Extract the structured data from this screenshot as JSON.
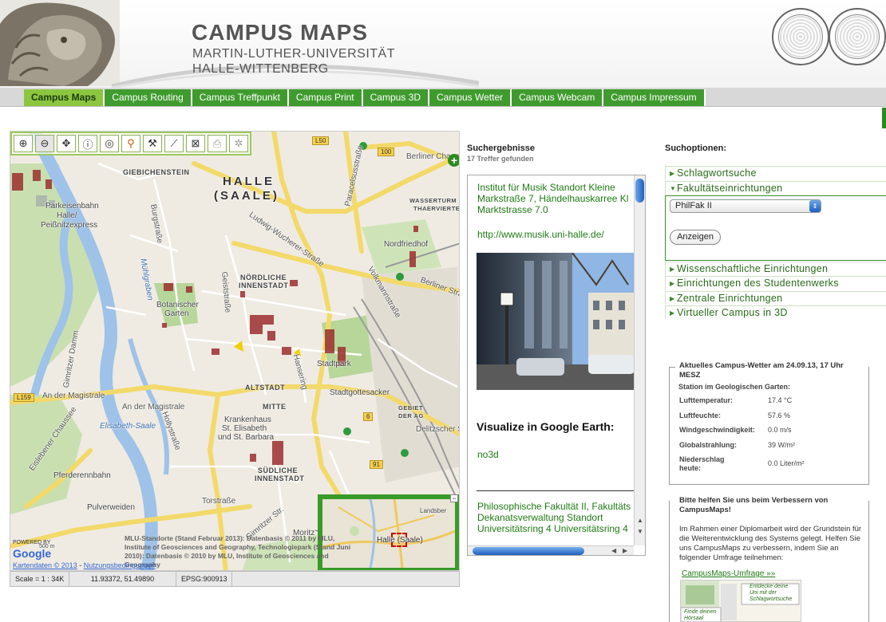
{
  "header": {
    "title": "CAMPUS MAPS",
    "subtitle_line1": "MARTIN-LUTHER-UNIVERSITÄT",
    "subtitle_line2": "HALLE-WITTENBERG"
  },
  "nav": {
    "tabs": [
      {
        "label": "Campus Maps",
        "active": true
      },
      {
        "label": "Campus Routing",
        "active": false
      },
      {
        "label": "Campus Treffpunkt",
        "active": false
      },
      {
        "label": "Campus Print",
        "active": false
      },
      {
        "label": "Campus 3D",
        "active": false
      },
      {
        "label": "Campus Wetter",
        "active": false
      },
      {
        "label": "Campus Webcam",
        "active": false
      },
      {
        "label": "Campus Impressum",
        "active": false
      }
    ]
  },
  "map": {
    "tools": [
      "zoom-in-icon",
      "zoom-out-icon",
      "pan-icon",
      "info-icon",
      "zoom-extent-icon",
      "search-icon",
      "measure-icon",
      "ruler-icon",
      "clear-icon",
      "print-icon",
      "settings-icon"
    ],
    "labels": {
      "city": "HALLE",
      "city2": "(SAALE)",
      "giebichenstein": "GIEBICHENSTEIN",
      "parkeisenbahn1": "Parkeisenbahn",
      "parkeisenbahn2": "Halle/",
      "parkeisenbahn3": "Peißnitzexpress",
      "burgstrasse": "Burgstraße",
      "paracelsus": "Paracelsusstraße",
      "berliner_chaussee": "Berliner Chaussee",
      "wasserturm1": "WASSERTURM -",
      "wasserturm2": "THAERVIERTEL",
      "nordfriedhof": "Nordfriedhof",
      "ludwig": "Ludwig-Wucherer-Straße",
      "berliner_strasse": "Berliner Straße",
      "volkmann": "Volkmannstraße",
      "noerdliche1": "NÖRDLICHE",
      "noerdliche2": "INNENSTADT",
      "botanischer1": "Botanischer",
      "botanischer2": "Garten",
      "geiststrasse": "Geiststraße",
      "muehlgraben": "Mühlgraben",
      "gimritzer_damm": "Gimritzer Damm",
      "altstadt": "ALTSTADT",
      "stadtpark": "Stadtpark",
      "hansering": "Hansering",
      "stadtgottesacker": "Stadtgottesacker",
      "l159": "L159",
      "magistrale1": "An der Magistrale",
      "magistrale2": "An der Magistrale",
      "mitte": "MITTE",
      "gebiet1": "GEBIET",
      "gebiet2": "DER AG",
      "krankenhaus1": "Krankenhaus",
      "krankenhaus2": "St. Elisabeth",
      "krankenhaus3": "und St. Barbara",
      "elisabeth_saale": "Elisabeth-Saale",
      "hollystrasse": "Hollystraße",
      "eislebener": "Eislebener Chaussee",
      "delitzscher": "Delitzscher S",
      "suedliche1": "SÜDLICHE",
      "suedliche2": "INNENSTADT",
      "pferderennbahn": "Pferderennbahn",
      "torstrasse": "Torstraße",
      "pulverweiden": "Pulverweiden",
      "gimritzer": "Gimritzer Str.",
      "leipziger": "Leipziger",
      "l50": "L50",
      "r100": "100",
      "r6": "6",
      "r91": "91",
      "moritz": "Moritz"
    },
    "overview": {
      "label": "Halle (Saale)",
      "landsberg": "Landsber"
    },
    "attribution": "MLU-Standorte (Stand Februar 2013): Datenbasis © 2011 by MLU, Institute of Geosciences and Geography, Technologiepark (Stand Juni 2010): Datenbasis © 2010 by MLU, Institute of Geosciences and Geography",
    "powered_by": "POWERED BY",
    "google": "Google",
    "scale_text": "500 m",
    "kartendaten": "Kartendaten © 2013",
    "nutzungs": "Nutzungsbedingungen",
    "status": {
      "scale": "Scale = 1 : 34K",
      "coords": "11.93372, 51.49890",
      "epsg": "EPSG:900913"
    }
  },
  "search_results": {
    "title": "Suchergebnisse",
    "count": "17 Treffer gefunden",
    "item1": [
      "Institut für Musik Standort Kleine",
      "Markstraße 7, Händelhauskarree Kl",
      "Marktstrasse 7.0"
    ],
    "item1_url": "http://www.musik.uni-halle.de/",
    "ge_title": "Visualize in Google Earth:",
    "ge_link": "no3d",
    "item2": [
      "Philosophische Fakultät II, Fakultäts",
      "Dekanatsverwaltung Standort",
      "Universitätsring 4 Universitätsring 4"
    ]
  },
  "search_options": {
    "title": "Suchoptionen:",
    "sections": [
      "Schlagwortsuche",
      "Fakultätseinrichtungen",
      "Wissenschaftliche Einrichtungen",
      "Einrichtungen des Studentenwerks",
      "Zentrale Einrichtungen",
      "Virtueller Campus in 3D"
    ],
    "selected_faculty": "PhilFak II",
    "show_button": "Anzeigen"
  },
  "weather": {
    "title": "Aktuelles Campus-Wetter am 24.09.13, 17 Uhr MESZ",
    "station": "Station im Geologischen Garten:",
    "rows": [
      {
        "label": "Lufttemperatur:",
        "value": "17.4 °C"
      },
      {
        "label": "Luftfeuchte:",
        "value": "57.6 %"
      },
      {
        "label": "Windgeschwindigkeit:",
        "value": "0.0 m/s"
      },
      {
        "label": "Globalstrahlung:",
        "value": "39 W/m²"
      },
      {
        "label": "Niederschlag heute:",
        "value": "0.0 Liter/m²"
      }
    ]
  },
  "feedback": {
    "title": "Bitte helfen Sie uns beim Verbessern von CampusMaps!",
    "text": "Im Rahmen einer Diplomarbeit wird der Grundstein für die Weiterentwicklung des Systems gelegt. Helfen Sie uns CampusMaps zu verbessern, indem Sie an folgender Umfrage teilnehmen:",
    "link": "CampusMaps-Umfrage  »»",
    "img_text1": "Entdecke deine",
    "img_text2": "Uni mit der",
    "img_text3": "Schlagwortsuche",
    "img_text4": "Finde deinen",
    "img_text5": "Hörsaal"
  },
  "colors": {
    "nav_green": "#3f9b2e",
    "nav_active": "#8cc63f",
    "link_green": "#1f7a14"
  }
}
